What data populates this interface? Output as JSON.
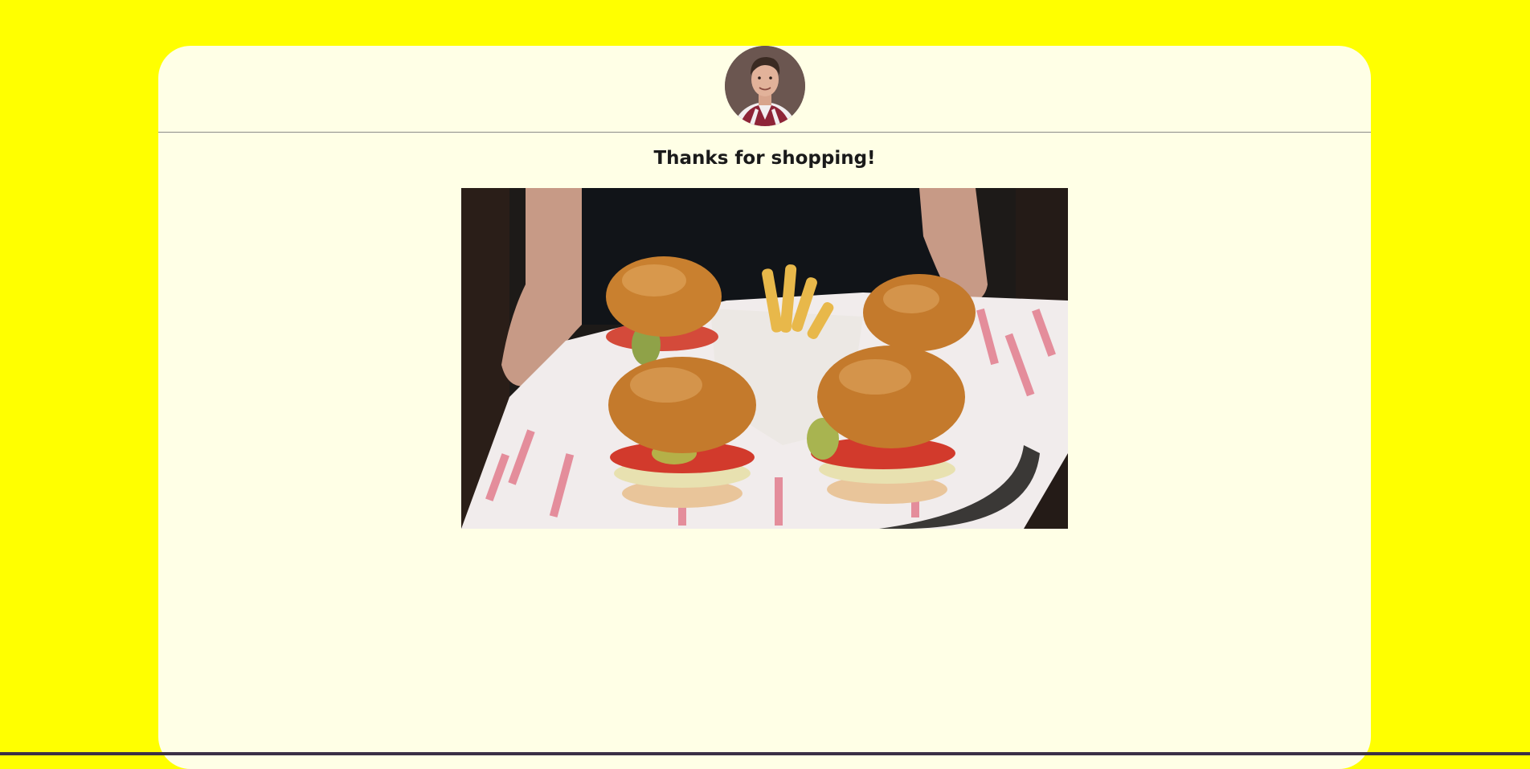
{
  "page": {
    "background_color": "#ffff00",
    "card_color": "#ffffe6"
  },
  "header": {
    "avatar": "profile-avatar"
  },
  "main": {
    "heading": "Thanks for shopping!",
    "image": "burgers-and-fries-tray-photo"
  }
}
